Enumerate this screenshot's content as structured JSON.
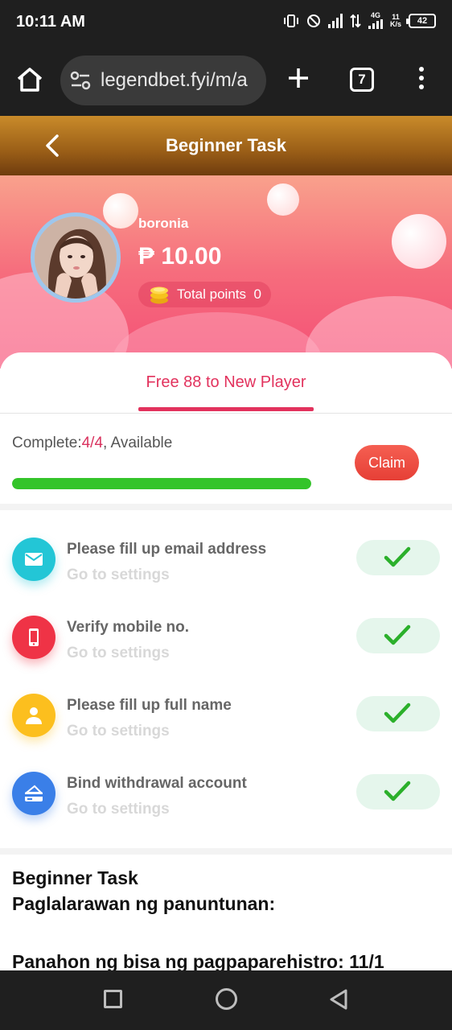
{
  "status_bar": {
    "time": "10:11 AM",
    "network_label": "4G",
    "speed": "11",
    "speed_unit": "K/s",
    "battery": "42"
  },
  "browser": {
    "url": "legendbet.fyi/m/a",
    "tab_count": "7"
  },
  "header": {
    "title": "Beginner Task"
  },
  "profile": {
    "username": "boronia",
    "balance": "₱ 10.00",
    "points_label": "Total points",
    "points_value": "0"
  },
  "tabs": [
    {
      "label": "Free 88 to New Player",
      "active": true
    }
  ],
  "progress": {
    "prefix": "Complete:",
    "value": "4/4",
    "suffix": ", Available",
    "fraction": 1.0,
    "claim_label": "Claim"
  },
  "tasks": [
    {
      "title": "Please fill up email address",
      "link": "Go to settings",
      "icon": "email-icon",
      "color": "#23c6d6",
      "completed": true
    },
    {
      "title": "Verify mobile no.",
      "link": "Go to settings",
      "icon": "phone-icon",
      "color": "#ef3346",
      "completed": true
    },
    {
      "title": "Please fill up full name",
      "link": "Go to settings",
      "icon": "person-icon",
      "color": "#fcbf1e",
      "completed": true
    },
    {
      "title": "Bind withdrawal account",
      "link": "Go to settings",
      "icon": "card-icon",
      "color": "#3a7fe8",
      "completed": true
    }
  ],
  "rules": {
    "heading": "Beginner Task",
    "subheading": "Paglalarawan ng panuntunan:",
    "line": "Panahon ng bisa ng pagpaparehistro: 11/1"
  },
  "colors": {
    "accent": "#e2325d",
    "claim": "#ea4a3e",
    "progress_fill": "#34c42a",
    "check": "#2bb02b",
    "header_gold": "#b57622"
  }
}
